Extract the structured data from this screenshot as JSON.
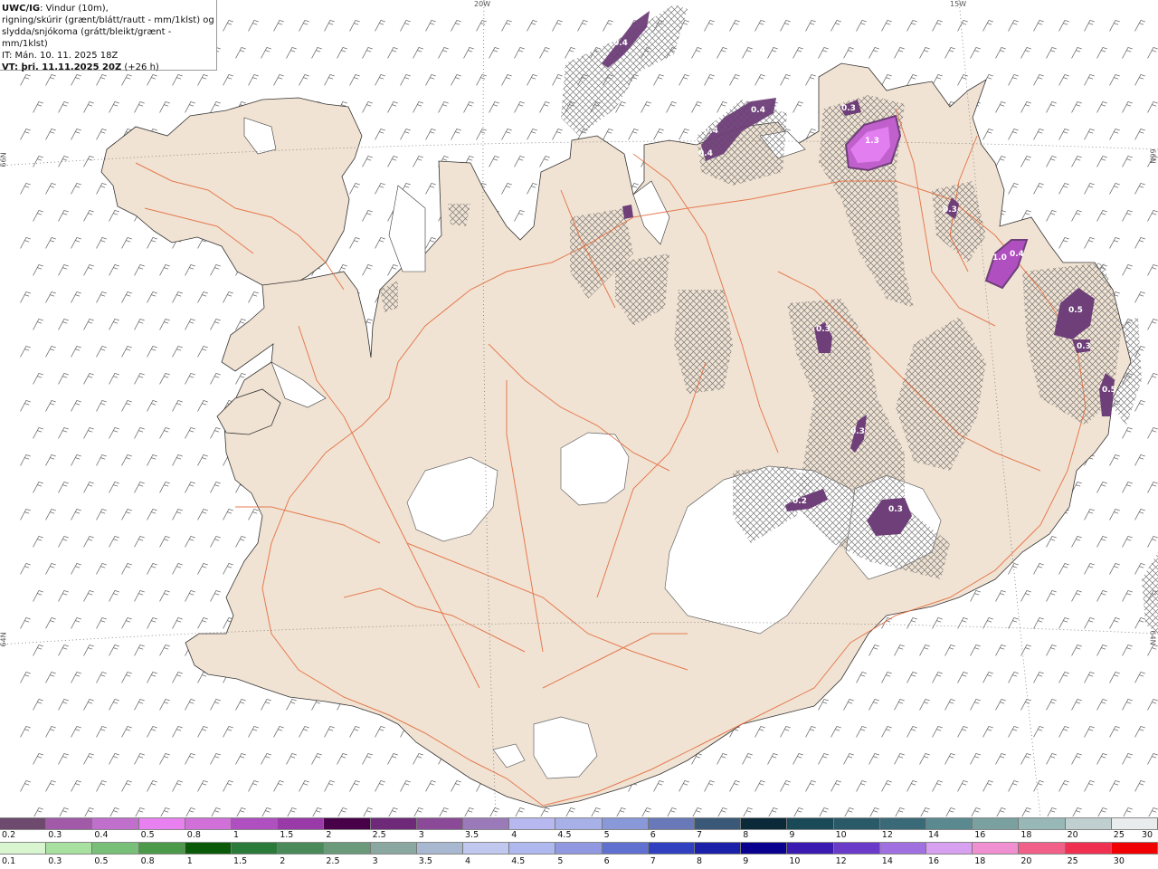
{
  "info": {
    "model": "UWC/IG",
    "line1_rest": ": Vindur (10m),",
    "line2": "rigning/skúrir (grænt/blátt/rautt - mm/1klst) og",
    "line3": "slydda/snjókoma (grátt/bleikt/grænt - mm/1klst)",
    "it": "IT: Mán. 10. 11. 2025 18Z",
    "vt_bold": "VT: þri. 11.11.2025 20Z",
    "vt_rest": " (+26 h)"
  },
  "grid_labels": {
    "w20": "20W",
    "w15": "15W",
    "n66_left": "66N",
    "n66_right": "66N",
    "n64_left": "64N",
    "n64_right": "64N"
  },
  "precip_labels": [
    "0.4",
    "0.4",
    "0.4",
    "0.4",
    "1.3",
    "0.3",
    "0.3",
    "1.0",
    "0.4",
    "0.5",
    "0.3",
    "0.5",
    "0.3",
    "0.3",
    "0.2",
    "0.3"
  ],
  "colors": {
    "land": "#f1e3d3",
    "ocean": "#ffffff",
    "roads": "#e2683a",
    "glacier": "#ffffff",
    "precip_dark": "#6e3f78",
    "precip_bright": "#e37ef0"
  },
  "snow_scale": {
    "labels": [
      "0.2",
      "0.3",
      "0.4",
      "0.5",
      "0.8",
      "1",
      "1.5",
      "2",
      "2.5",
      "3",
      "3.5",
      "4",
      "4.5",
      "5",
      "6",
      "7",
      "8",
      "9",
      "10",
      "12",
      "14",
      "16",
      "18",
      "20",
      "25",
      "30"
    ],
    "colors": [
      "#6e4a6e",
      "#a05aa8",
      "#c070cc",
      "#e880f0",
      "#d070d8",
      "#b050c0",
      "#9a3aa8",
      "#480048",
      "#6e2a78",
      "#8a4a98",
      "#9a7ab8",
      "#b8b8f0",
      "#a8b0e8",
      "#8898d8",
      "#6878b8",
      "#3a5878",
      "#0a2a3a",
      "#1a4a58",
      "#2a5a68",
      "#3a6a78",
      "#5a8a90",
      "#7aa0a0",
      "#98b8b8",
      "#c0d0d0",
      "#e8ecec"
    ]
  },
  "rain_scale": {
    "labels": [
      "0.1",
      "0.3",
      "0.5",
      "0.8",
      "1",
      "1.5",
      "2",
      "2.5",
      "3",
      "3.5",
      "4",
      "4.5",
      "5",
      "6",
      "7",
      "8",
      "9",
      "10",
      "12",
      "14",
      "16",
      "18",
      "20",
      "25",
      "30"
    ],
    "colors": [
      "#d8f5d0",
      "#a8e0a0",
      "#78c078",
      "#4a9a4a",
      "#0a5a0a",
      "#2a7a3a",
      "#4a8a5a",
      "#6a9a7a",
      "#8aa8a0",
      "#a8b8d0",
      "#c0c8f0",
      "#b0b8f0",
      "#9098e0",
      "#6070d0",
      "#3040c0",
      "#1a20a8",
      "#0a0090",
      "#3a1ab0",
      "#6a3ac8",
      "#a070e0",
      "#d8a0f0",
      "#f090d0",
      "#f06088",
      "#f03050",
      "#f00000"
    ]
  }
}
